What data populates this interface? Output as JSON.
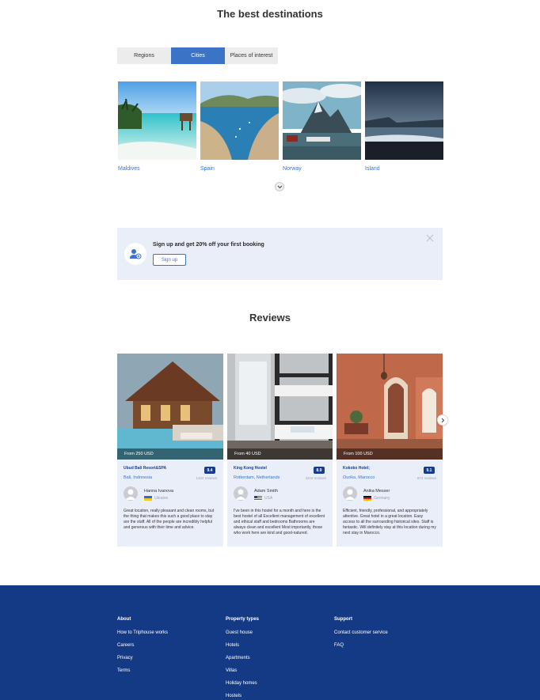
{
  "destinations": {
    "title": "The best destinations",
    "tabs": [
      "Regions",
      "Cities",
      "Places of interest"
    ],
    "active_tab": "Cities",
    "items": [
      {
        "name": "Maldives"
      },
      {
        "name": "Spain"
      },
      {
        "name": "Norway"
      },
      {
        "name": "Island"
      }
    ]
  },
  "signup": {
    "text": "Sign up and get 20% off your first booking",
    "button": "Sign up"
  },
  "reviews": {
    "title": "Reviews",
    "cards": [
      {
        "price": "From 250 USD",
        "hotel": "Ubud Bali Resort&SPA",
        "location": "Bali, Indonesia",
        "score": "9.4",
        "review_count": "1324 reviews",
        "reviewer": "Hanna Ivanova",
        "country": "Ukraine",
        "text": "Great location, really pleasant and clean rooms, but the thing that makes this such a good place to stay are the staff. All of the people are incredibly helpful and generous with their time and advice."
      },
      {
        "price": "From 40 USD",
        "hotel": "King Kong Hostel",
        "location": "Rotterdam, Netherlands",
        "score": "8.9",
        "review_count": "3216 reviews",
        "reviewer": "Adam Smith",
        "country": "USA",
        "text": "I've been in this hostel for a month and here is the best hostel of all Excellent management of excellent and ethical staff and bedrooms Bathrooms are always clean and excellent Most importantly, those who work here are kind and good-natured."
      },
      {
        "price": "From 100 USD",
        "hotel": "Kokoko Hotel;",
        "location": "Ourika, Marocco",
        "score": "9.1",
        "review_count": "873 reviews",
        "reviewer": "Anika Messer",
        "country": "Germany",
        "text": "Efficient, friendly, professional, and appropriately attentive. Great hotel in a great location. Easy access to all the surrounding historical sites. Staff is fantastic. Will definitely stay at this location during my next stay in Marocco."
      }
    ]
  },
  "footer": {
    "columns": [
      {
        "heading": "About",
        "links": [
          "How to Triphouse works",
          "Careers",
          "Privacy",
          "Terms"
        ]
      },
      {
        "heading": "Property types",
        "links": [
          "Guest house",
          "Hotels",
          "Apartments",
          "Villas",
          "Holiday homes",
          "Hostels"
        ]
      },
      {
        "heading": "Support",
        "links": [
          "Contact customer service",
          "FAQ"
        ]
      }
    ]
  },
  "colors": {
    "accent": "#3b73c6",
    "footer_bg": "#153a85",
    "panel_bg": "#e9eef8"
  },
  "icons": [
    "chevron-down-icon",
    "add-user-icon",
    "close-icon",
    "chevron-right-icon",
    "user-avatar-icon"
  ]
}
